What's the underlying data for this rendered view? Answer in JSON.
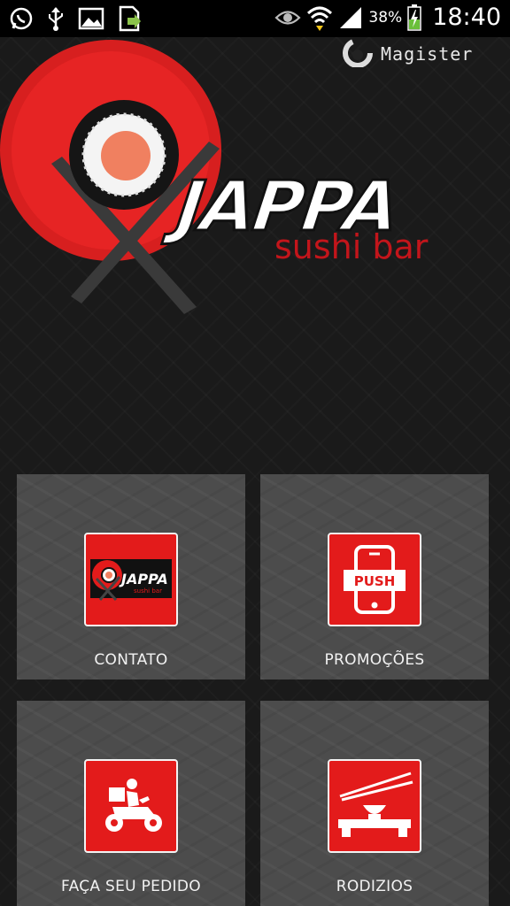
{
  "status_bar": {
    "icons_left": [
      "whatsapp-icon",
      "usb-icon",
      "image-icon",
      "download-file-icon"
    ],
    "icons_right": [
      "eye-icon",
      "wifi-icon",
      "signal-icon",
      "battery-icon"
    ],
    "battery_percent": "38%",
    "time": "18:40"
  },
  "brand": {
    "magister": "Magister",
    "logo_title": "JAPPA",
    "logo_subtitle": "sushi bar",
    "colors": {
      "red": "#e31b1b",
      "dark": "#141414",
      "tile": "#4c4c4c",
      "salmon": "#f08060"
    }
  },
  "tiles": [
    {
      "label": "CONTATO",
      "icon": "jappa-logo-icon",
      "mini_title": "JAPPA",
      "mini_subtitle": "sushi bar"
    },
    {
      "label": "PROMOÇÕES",
      "icon": "push-phone-icon",
      "badge": "PUSH"
    },
    {
      "label": "FAÇA SEU PEDIDO",
      "icon": "delivery-motorbike-icon"
    },
    {
      "label": "RODIZIOS",
      "icon": "sushi-board-chopsticks-icon"
    }
  ]
}
